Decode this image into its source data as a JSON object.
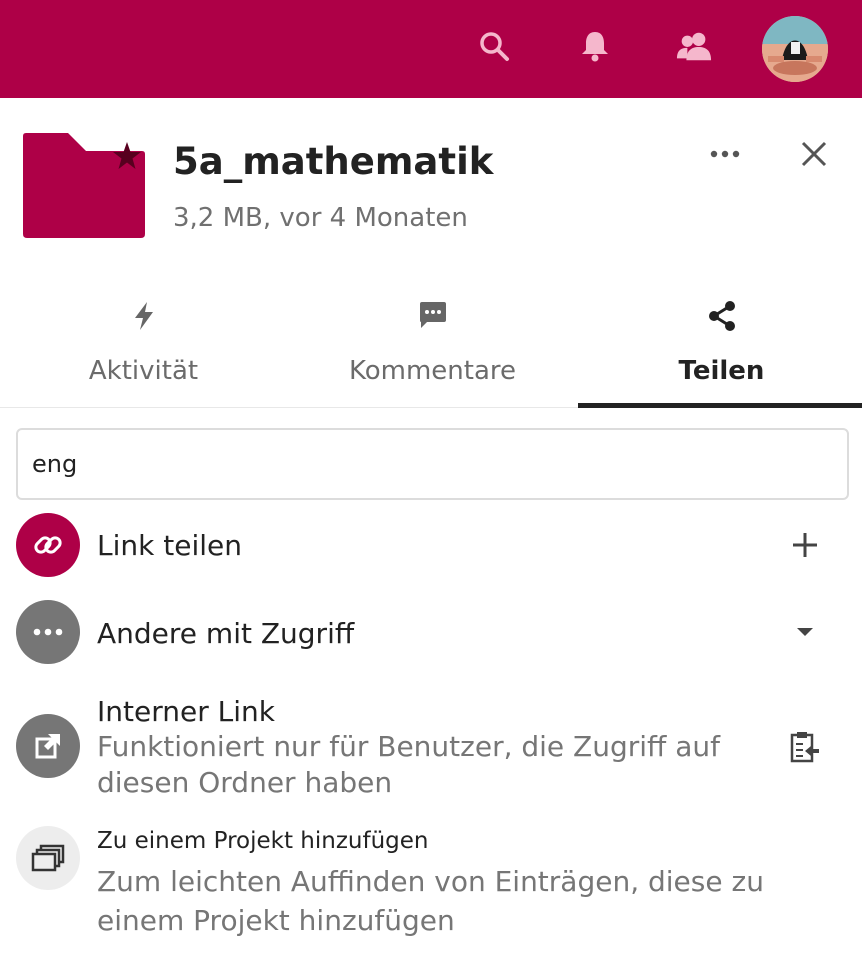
{
  "header": {
    "icons": [
      "search-icon",
      "bell-icon",
      "contacts-icon"
    ],
    "accent_color": "#ae0047"
  },
  "file": {
    "name": "5a_mathematik",
    "meta": "3,2 MB, vor 4 Monaten",
    "icon": "folder-star-icon",
    "folder_color": "#ae0047"
  },
  "tabs": [
    {
      "label": "Aktivität",
      "icon": "activity-icon",
      "active": false
    },
    {
      "label": "Kommentare",
      "icon": "comment-icon",
      "active": false
    },
    {
      "label": "Teilen",
      "icon": "share-icon",
      "active": true
    }
  ],
  "search": {
    "value": "eng"
  },
  "share": {
    "link": {
      "label": "Link teilen",
      "icon": "link-icon",
      "action_icon": "plus-icon",
      "color": "#ae0047"
    },
    "others": {
      "label": "Andere mit Zugriff",
      "icon": "more-horizontal-icon",
      "action_icon": "triangle-down-icon",
      "color": "#767676"
    },
    "internal": {
      "title": "Interner Link",
      "desc": "Funktioniert nur für Benutzer, die Zugriff auf diesen Ordner haben",
      "icon": "external-link-icon",
      "action_icon": "clipboard-icon",
      "color": "#767676"
    },
    "project": {
      "title": "Zu einem Projekt hinzufügen",
      "desc": "Zum leichten Auffinden von Einträgen, diese zu einem Projekt hinzufügen",
      "icon": "projects-icon",
      "color": "#ededed"
    }
  }
}
